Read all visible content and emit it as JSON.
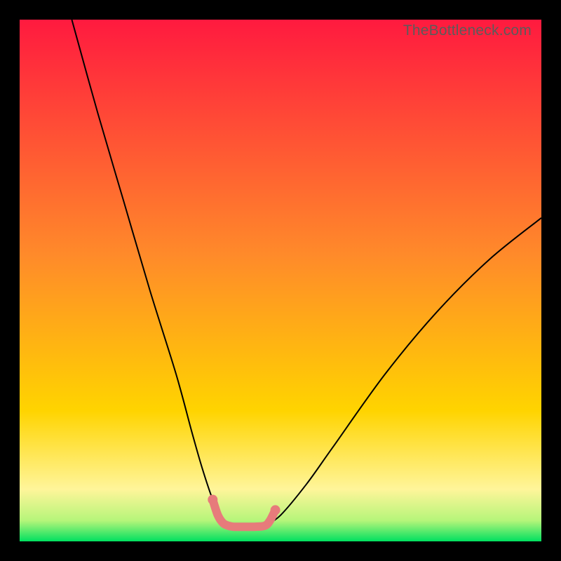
{
  "watermark": "TheBottleneck.com",
  "gradient_colors": {
    "c0": "#ff1a3f",
    "c1": "#ff8a2a",
    "c2": "#ffd400",
    "c3": "#fff59a",
    "c4": "#b6f57a",
    "c5": "#00e060"
  },
  "chart_data": {
    "type": "line",
    "title": "",
    "xlabel": "",
    "ylabel": "",
    "xlim": [
      0,
      100
    ],
    "ylim": [
      0,
      100
    ],
    "series": [
      {
        "name": "left-branch",
        "x": [
          10,
          15,
          20,
          25,
          30,
          33,
          35,
          37,
          38.5,
          40
        ],
        "y": [
          100,
          82,
          65,
          48,
          32,
          21,
          14,
          8,
          4.5,
          3
        ]
      },
      {
        "name": "right-branch",
        "x": [
          47,
          50,
          55,
          60,
          70,
          80,
          90,
          100
        ],
        "y": [
          3,
          5,
          11,
          18,
          32,
          44,
          54,
          62
        ]
      },
      {
        "name": "flat-bottom-highlight",
        "x": [
          37,
          38,
          39,
          40,
          41,
          43,
          45,
          47,
          48,
          49
        ],
        "y": [
          8,
          5,
          3.5,
          3,
          2.8,
          2.8,
          2.8,
          3,
          4,
          6
        ]
      }
    ],
    "highlight_style": {
      "stroke": "#e77b7b",
      "stroke_width": 12,
      "dot_radius": 7
    }
  }
}
